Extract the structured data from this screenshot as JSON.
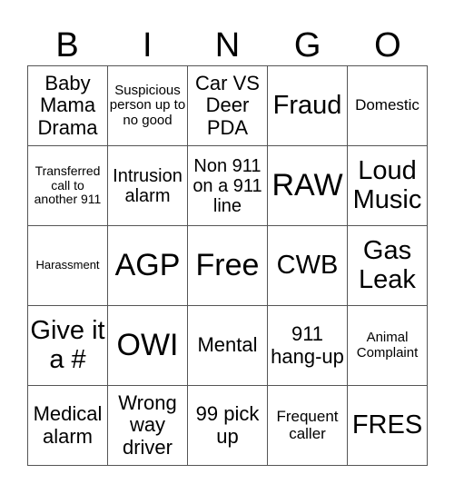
{
  "header": {
    "letters": [
      "B",
      "I",
      "N",
      "G",
      "O"
    ]
  },
  "grid": {
    "rows": [
      [
        "Baby Mama Drama",
        "Suspicious person up to no good",
        "Car VS Deer PDA",
        "Fraud",
        "Domestic"
      ],
      [
        "Transferred call to another 911",
        "Intrusion alarm",
        "Non 911 on a 911 line",
        "RAW",
        "Loud Music"
      ],
      [
        "Harassment",
        "AGP",
        "Free",
        "CWB",
        "Gas Leak"
      ],
      [
        "Give it a #",
        "OWI",
        "Mental",
        "911 hang-up",
        "Animal Complaint"
      ],
      [
        "Medical alarm",
        "Wrong way driver",
        "99 pick up",
        "Frequent caller",
        "FRES"
      ]
    ]
  }
}
